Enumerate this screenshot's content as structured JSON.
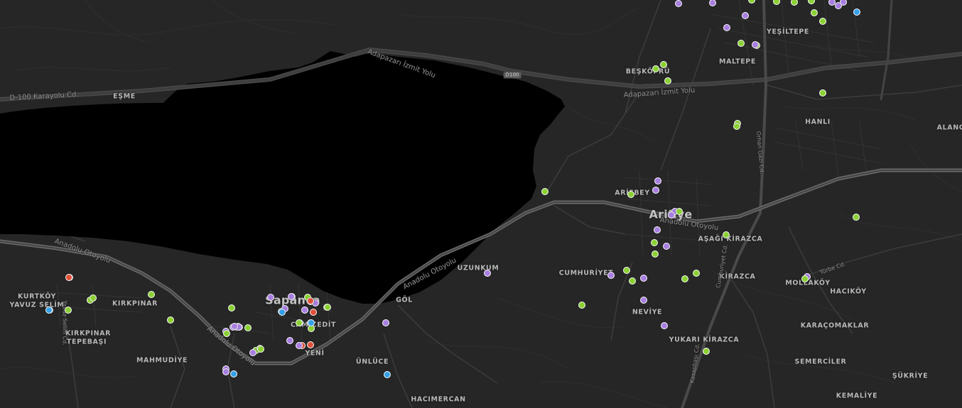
{
  "map": {
    "colors": {
      "land": "#262626",
      "water": "#000000",
      "motorway": "#5a5a5a",
      "road": "#3a3a3a",
      "label": "#b8b8b8"
    },
    "marker_colors": {
      "green": "#8bd034",
      "purple": "#a87ee0",
      "red": "#e0503a",
      "blue": "#35a0e8"
    },
    "places": [
      {
        "name": "YEŞİLTEPE",
        "type": "district"
      },
      {
        "name": "MALTEPE",
        "type": "district"
      },
      {
        "name": "BEŞKÖPRÜ",
        "type": "district"
      },
      {
        "name": "HANLI",
        "type": "district"
      },
      {
        "name": "ALANC",
        "type": "district"
      },
      {
        "name": "EŞME",
        "type": "district"
      },
      {
        "name": "ARİFBEY",
        "type": "district"
      },
      {
        "name": "Arifiye",
        "type": "town"
      },
      {
        "name": "AŞAĞI KİRAZCA",
        "type": "district"
      },
      {
        "name": "UZUNKUM",
        "type": "district"
      },
      {
        "name": "CUMHURİYET",
        "type": "district"
      },
      {
        "name": "KİRAZCA",
        "type": "district"
      },
      {
        "name": "MOLLAKÖY",
        "type": "district"
      },
      {
        "name": "HACIKÖY",
        "type": "district"
      },
      {
        "name": "NEVİYE",
        "type": "district"
      },
      {
        "name": "KARAÇOMAKLAR",
        "type": "district"
      },
      {
        "name": "YUKARI KİRAZCA",
        "type": "district"
      },
      {
        "name": "SEMERCİLER",
        "type": "district"
      },
      {
        "name": "ŞÜKRİYE",
        "type": "district"
      },
      {
        "name": "KEMALİYE",
        "type": "district"
      },
      {
        "name": "KURTKÖY",
        "type": "district"
      },
      {
        "name": "YAVUZ SELİM",
        "type": "district"
      },
      {
        "name": "KIRKPINAR",
        "type": "district"
      },
      {
        "name": "KIRKPINAR",
        "type": "district"
      },
      {
        "name": "TEPEBAŞI",
        "type": "district"
      },
      {
        "name": "Sapanca",
        "type": "town"
      },
      {
        "name": "GÖL",
        "type": "district"
      },
      {
        "name": "CAMİCEDİT",
        "type": "district"
      },
      {
        "name": "MAHMUDİYE",
        "type": "district"
      },
      {
        "name": "YENİ",
        "type": "district"
      },
      {
        "name": "ÜNLÜCE",
        "type": "district"
      },
      {
        "name": "HACIMERCAN",
        "type": "district"
      }
    ],
    "roads": [
      {
        "name": "Anadolu Otoyolu",
        "class": "motorway"
      },
      {
        "name": "Anadolu Otoyolu",
        "class": "motorway"
      },
      {
        "name": "Anadolu Otoyolu",
        "class": "motorway"
      },
      {
        "name": "Anadolu Otoyolu",
        "class": "motorway"
      },
      {
        "name": "Adapazarı İzmit Yolu",
        "class": "trunk"
      },
      {
        "name": "Adapazarı İzmit Yolu",
        "class": "trunk"
      },
      {
        "name": "D-100 Karayolu Cd.",
        "class": "trunk"
      },
      {
        "name": "Orhan Gazi Cd.",
        "class": "street"
      },
      {
        "name": "Türbe Cd.",
        "class": "street"
      },
      {
        "name": "Yavuz Selim Cd.",
        "class": "street"
      },
      {
        "name": "Cumhuriyet Cd.",
        "class": "street"
      },
      {
        "name": "Kasapbaşı Cd.",
        "class": "street"
      }
    ],
    "shields": [
      "D100"
    ],
    "markers": [
      {
        "color": "purple"
      },
      {
        "color": "purple"
      },
      {
        "color": "green"
      },
      {
        "color": "green"
      },
      {
        "color": "green"
      },
      {
        "color": "green"
      },
      {
        "color": "purple"
      },
      {
        "color": "purple"
      },
      {
        "color": "blue"
      },
      {
        "color": "purple"
      },
      {
        "color": "purple"
      },
      {
        "color": "green"
      },
      {
        "color": "green"
      },
      {
        "color": "purple"
      },
      {
        "color": "green"
      },
      {
        "color": "green"
      },
      {
        "color": "green"
      },
      {
        "color": "green"
      },
      {
        "color": "green"
      },
      {
        "color": "green"
      },
      {
        "color": "green"
      },
      {
        "color": "purple"
      },
      {
        "color": "purple"
      },
      {
        "color": "green"
      },
      {
        "color": "purple"
      },
      {
        "color": "green"
      },
      {
        "color": "purple"
      },
      {
        "color": "purple"
      },
      {
        "color": "green"
      },
      {
        "color": "green"
      },
      {
        "color": "green"
      },
      {
        "color": "green"
      },
      {
        "color": "purple"
      },
      {
        "color": "green"
      },
      {
        "color": "green"
      },
      {
        "color": "purple"
      },
      {
        "color": "green"
      },
      {
        "color": "purple"
      },
      {
        "color": "purple"
      },
      {
        "color": "green"
      },
      {
        "color": "green"
      },
      {
        "color": "purple"
      },
      {
        "color": "green"
      },
      {
        "color": "purple"
      },
      {
        "color": "green"
      },
      {
        "color": "red"
      },
      {
        "color": "blue"
      },
      {
        "color": "green"
      },
      {
        "color": "green"
      },
      {
        "color": "green"
      },
      {
        "color": "green"
      },
      {
        "color": "green"
      },
      {
        "color": "green"
      },
      {
        "color": "purple"
      },
      {
        "color": "purple"
      },
      {
        "color": "red"
      },
      {
        "color": "blue"
      },
      {
        "color": "purple"
      },
      {
        "color": "green"
      },
      {
        "color": "purple"
      },
      {
        "color": "purple"
      },
      {
        "color": "blue"
      },
      {
        "color": "red"
      },
      {
        "color": "green"
      },
      {
        "color": "purple"
      },
      {
        "color": "purple"
      },
      {
        "color": "purple"
      },
      {
        "color": "green"
      },
      {
        "color": "green"
      },
      {
        "color": "green"
      },
      {
        "color": "purple"
      },
      {
        "color": "purple"
      },
      {
        "color": "purple"
      },
      {
        "color": "green"
      },
      {
        "color": "green"
      },
      {
        "color": "purple"
      },
      {
        "color": "red"
      },
      {
        "color": "red"
      },
      {
        "color": "purple"
      },
      {
        "color": "purple"
      },
      {
        "color": "blue"
      },
      {
        "color": "purple"
      },
      {
        "color": "blue"
      },
      {
        "color": "purple"
      },
      {
        "color": "green"
      },
      {
        "color": "green"
      },
      {
        "color": "purple"
      },
      {
        "color": "red"
      },
      {
        "color": "blue"
      },
      {
        "color": "green"
      },
      {
        "color": "green"
      },
      {
        "color": "green"
      },
      {
        "color": "green"
      },
      {
        "color": "red"
      },
      {
        "color": "purple"
      },
      {
        "color": "purple"
      },
      {
        "color": "purple"
      },
      {
        "color": "blue"
      },
      {
        "color": "blue"
      },
      {
        "color": "purple"
      },
      {
        "color": "green"
      },
      {
        "color": "purple"
      }
    ]
  }
}
